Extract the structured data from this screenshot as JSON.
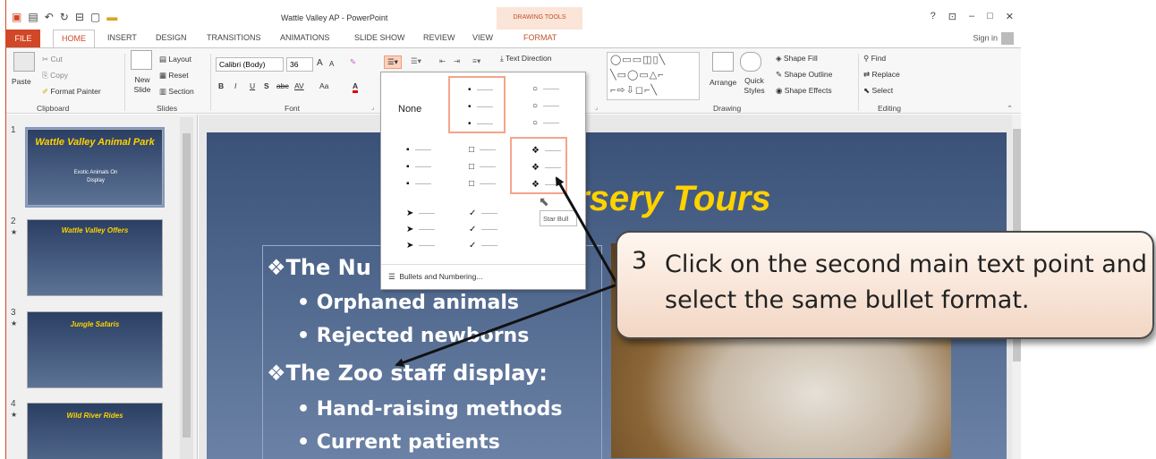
{
  "window": {
    "title": "Wattle Valley AP - PowerPoint",
    "contextual_group": "DRAWING TOOLS",
    "controls": [
      "?",
      "⊡",
      "–",
      "□",
      "✕"
    ]
  },
  "tabs": [
    "FILE",
    "HOME",
    "INSERT",
    "DESIGN",
    "TRANSITIONS",
    "ANIMATIONS",
    "SLIDE SHOW",
    "REVIEW",
    "VIEW",
    "FORMAT"
  ],
  "signin": "Sign in",
  "ribbon": {
    "clipboard": {
      "paste": "Paste",
      "cut": "Cut",
      "copy": "Copy",
      "format_painter": "Format Painter",
      "label": "Clipboard"
    },
    "slides": {
      "new_slide": "New Slide",
      "layout": "Layout",
      "reset": "Reset",
      "section": "Section",
      "label": "Slides"
    },
    "font": {
      "name": "Calibri (Body)",
      "size": "36",
      "bold": "B",
      "italic": "I",
      "underline": "U",
      "shadow": "S",
      "strike": "abc",
      "spacing": "AV",
      "case": "Aa",
      "color": "A",
      "grow": "A",
      "shrink": "A",
      "label": "Font"
    },
    "paragraph": {
      "text_direction": "Text Direction"
    },
    "drawing": {
      "arrange": "Arrange",
      "quick_styles": "Quick Styles",
      "shape_fill": "Shape Fill",
      "shape_outline": "Shape Outline",
      "shape_effects": "Shape Effects",
      "label": "Drawing"
    },
    "editing": {
      "find": "Find",
      "replace": "Replace",
      "select": "Select",
      "label": "Editing"
    }
  },
  "slides_panel": [
    {
      "num": "1",
      "title": "Wattle Valley Animal Park",
      "sub": "Exotic Animals On Display"
    },
    {
      "num": "2",
      "title": "Wattle Valley Offers"
    },
    {
      "num": "3",
      "title": "Jungle Safaris"
    },
    {
      "num": "4",
      "title": "Wild River Rides"
    }
  ],
  "slide": {
    "title": "rsery Tours",
    "bullets": [
      {
        "text": "❖The Nu",
        "level": 1
      },
      {
        "text": "• Orphaned animals",
        "level": 2
      },
      {
        "text": "• Rejected newborns",
        "level": 2
      },
      {
        "text": "❖The Zoo staff display:",
        "level": 1
      },
      {
        "text": "• Hand-raising methods",
        "level": 2
      },
      {
        "text": "• Current patients",
        "level": 2
      }
    ]
  },
  "bullet_menu": {
    "none_label": "None",
    "footer": "Bullets and Numbering...",
    "tooltip": "Star Bull"
  },
  "callout": {
    "number": "3",
    "text": "Click on the second main text point and select the same bullet format."
  }
}
